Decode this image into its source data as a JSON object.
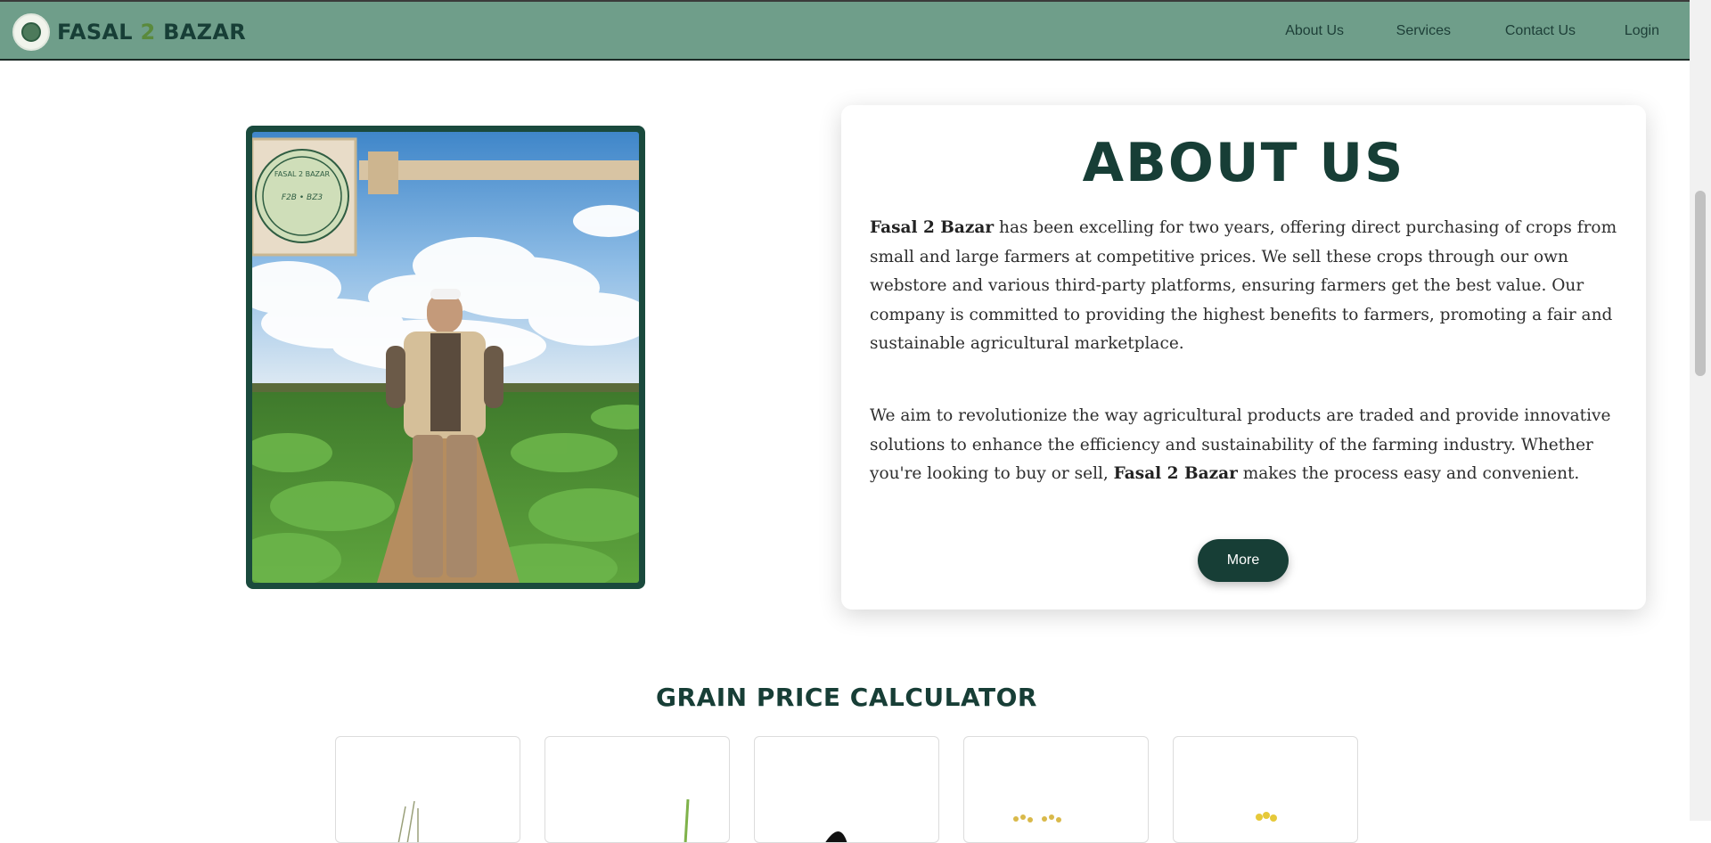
{
  "brand": {
    "part1": "FASAL ",
    "part2": "2",
    "part3": " BAZAR",
    "logo_icon": "fasal2bazar-logo"
  },
  "nav": {
    "items": [
      {
        "label": "About Us"
      },
      {
        "label": "Services"
      },
      {
        "label": "Contact Us"
      },
      {
        "label": "Login"
      }
    ]
  },
  "about": {
    "title": "ABOUT US",
    "p1_brand": "Fasal 2 Bazar",
    "p1_text": " has been excelling for two years, offering direct purchasing of crops from small and large farmers at competitive prices. We sell these crops through our own webstore and various third-party platforms, ensuring farmers get the best value. Our company is committed to providing the highest benefits to farmers, promoting a fair and sustainable agricultural marketplace.",
    "p2_text_a": "We aim to revolutionize the way agricultural products are traded and provide innovative solutions to enhance the efficiency and sustainability of the farming industry. Whether you're looking to buy or sell, ",
    "p2_brand": "Fasal 2 Bazar",
    "p2_text_b": " makes the process easy and convenient.",
    "more_label": "More",
    "sign_text_top": "FASAL 2 BAZAR",
    "sign_text_mid": "F2B • BZ3",
    "photo_subject": "farmer-in-field"
  },
  "grain": {
    "title": "GRAIN PRICE CALCULATOR",
    "cards": [
      {
        "icon": "wheat-icon"
      },
      {
        "icon": "rice-icon"
      },
      {
        "icon": "grain-icon"
      },
      {
        "icon": "mustard-icon"
      },
      {
        "icon": "maize-icon"
      }
    ]
  },
  "colors": {
    "navbar": "#6f9e8a",
    "brand_dark": "#173e36",
    "accent_green": "#5a8a3c"
  }
}
